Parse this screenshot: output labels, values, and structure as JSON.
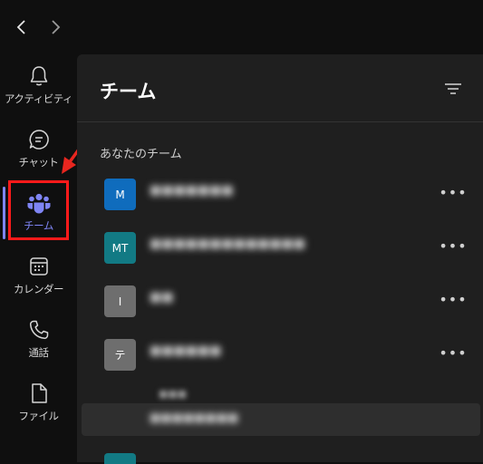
{
  "rail": {
    "items": [
      {
        "label": "アクティビティ"
      },
      {
        "label": "チャット"
      },
      {
        "label": "チーム"
      },
      {
        "label": "カレンダー"
      },
      {
        "label": "通話"
      },
      {
        "label": "ファイル"
      }
    ]
  },
  "panel": {
    "title": "チーム",
    "section_label": "あなたのチーム",
    "more_label": "•••",
    "teams": [
      {
        "initials": "M",
        "name": "■■■■■■■",
        "color": "#0f6cbd"
      },
      {
        "initials": "MT",
        "name": "■■■■■■■■■■■■■",
        "color": "#127a84"
      },
      {
        "initials": "I",
        "name": "■■",
        "color": "#6e6e6e"
      },
      {
        "initials": "テ",
        "name": "■■■■■■",
        "color": "#6e6e6e"
      }
    ],
    "channel": {
      "name": "■■■■■■■■"
    },
    "sub_text": "■■■"
  },
  "colors": {
    "accent": "#7f85f5",
    "highlight": "#ff1a1a"
  }
}
